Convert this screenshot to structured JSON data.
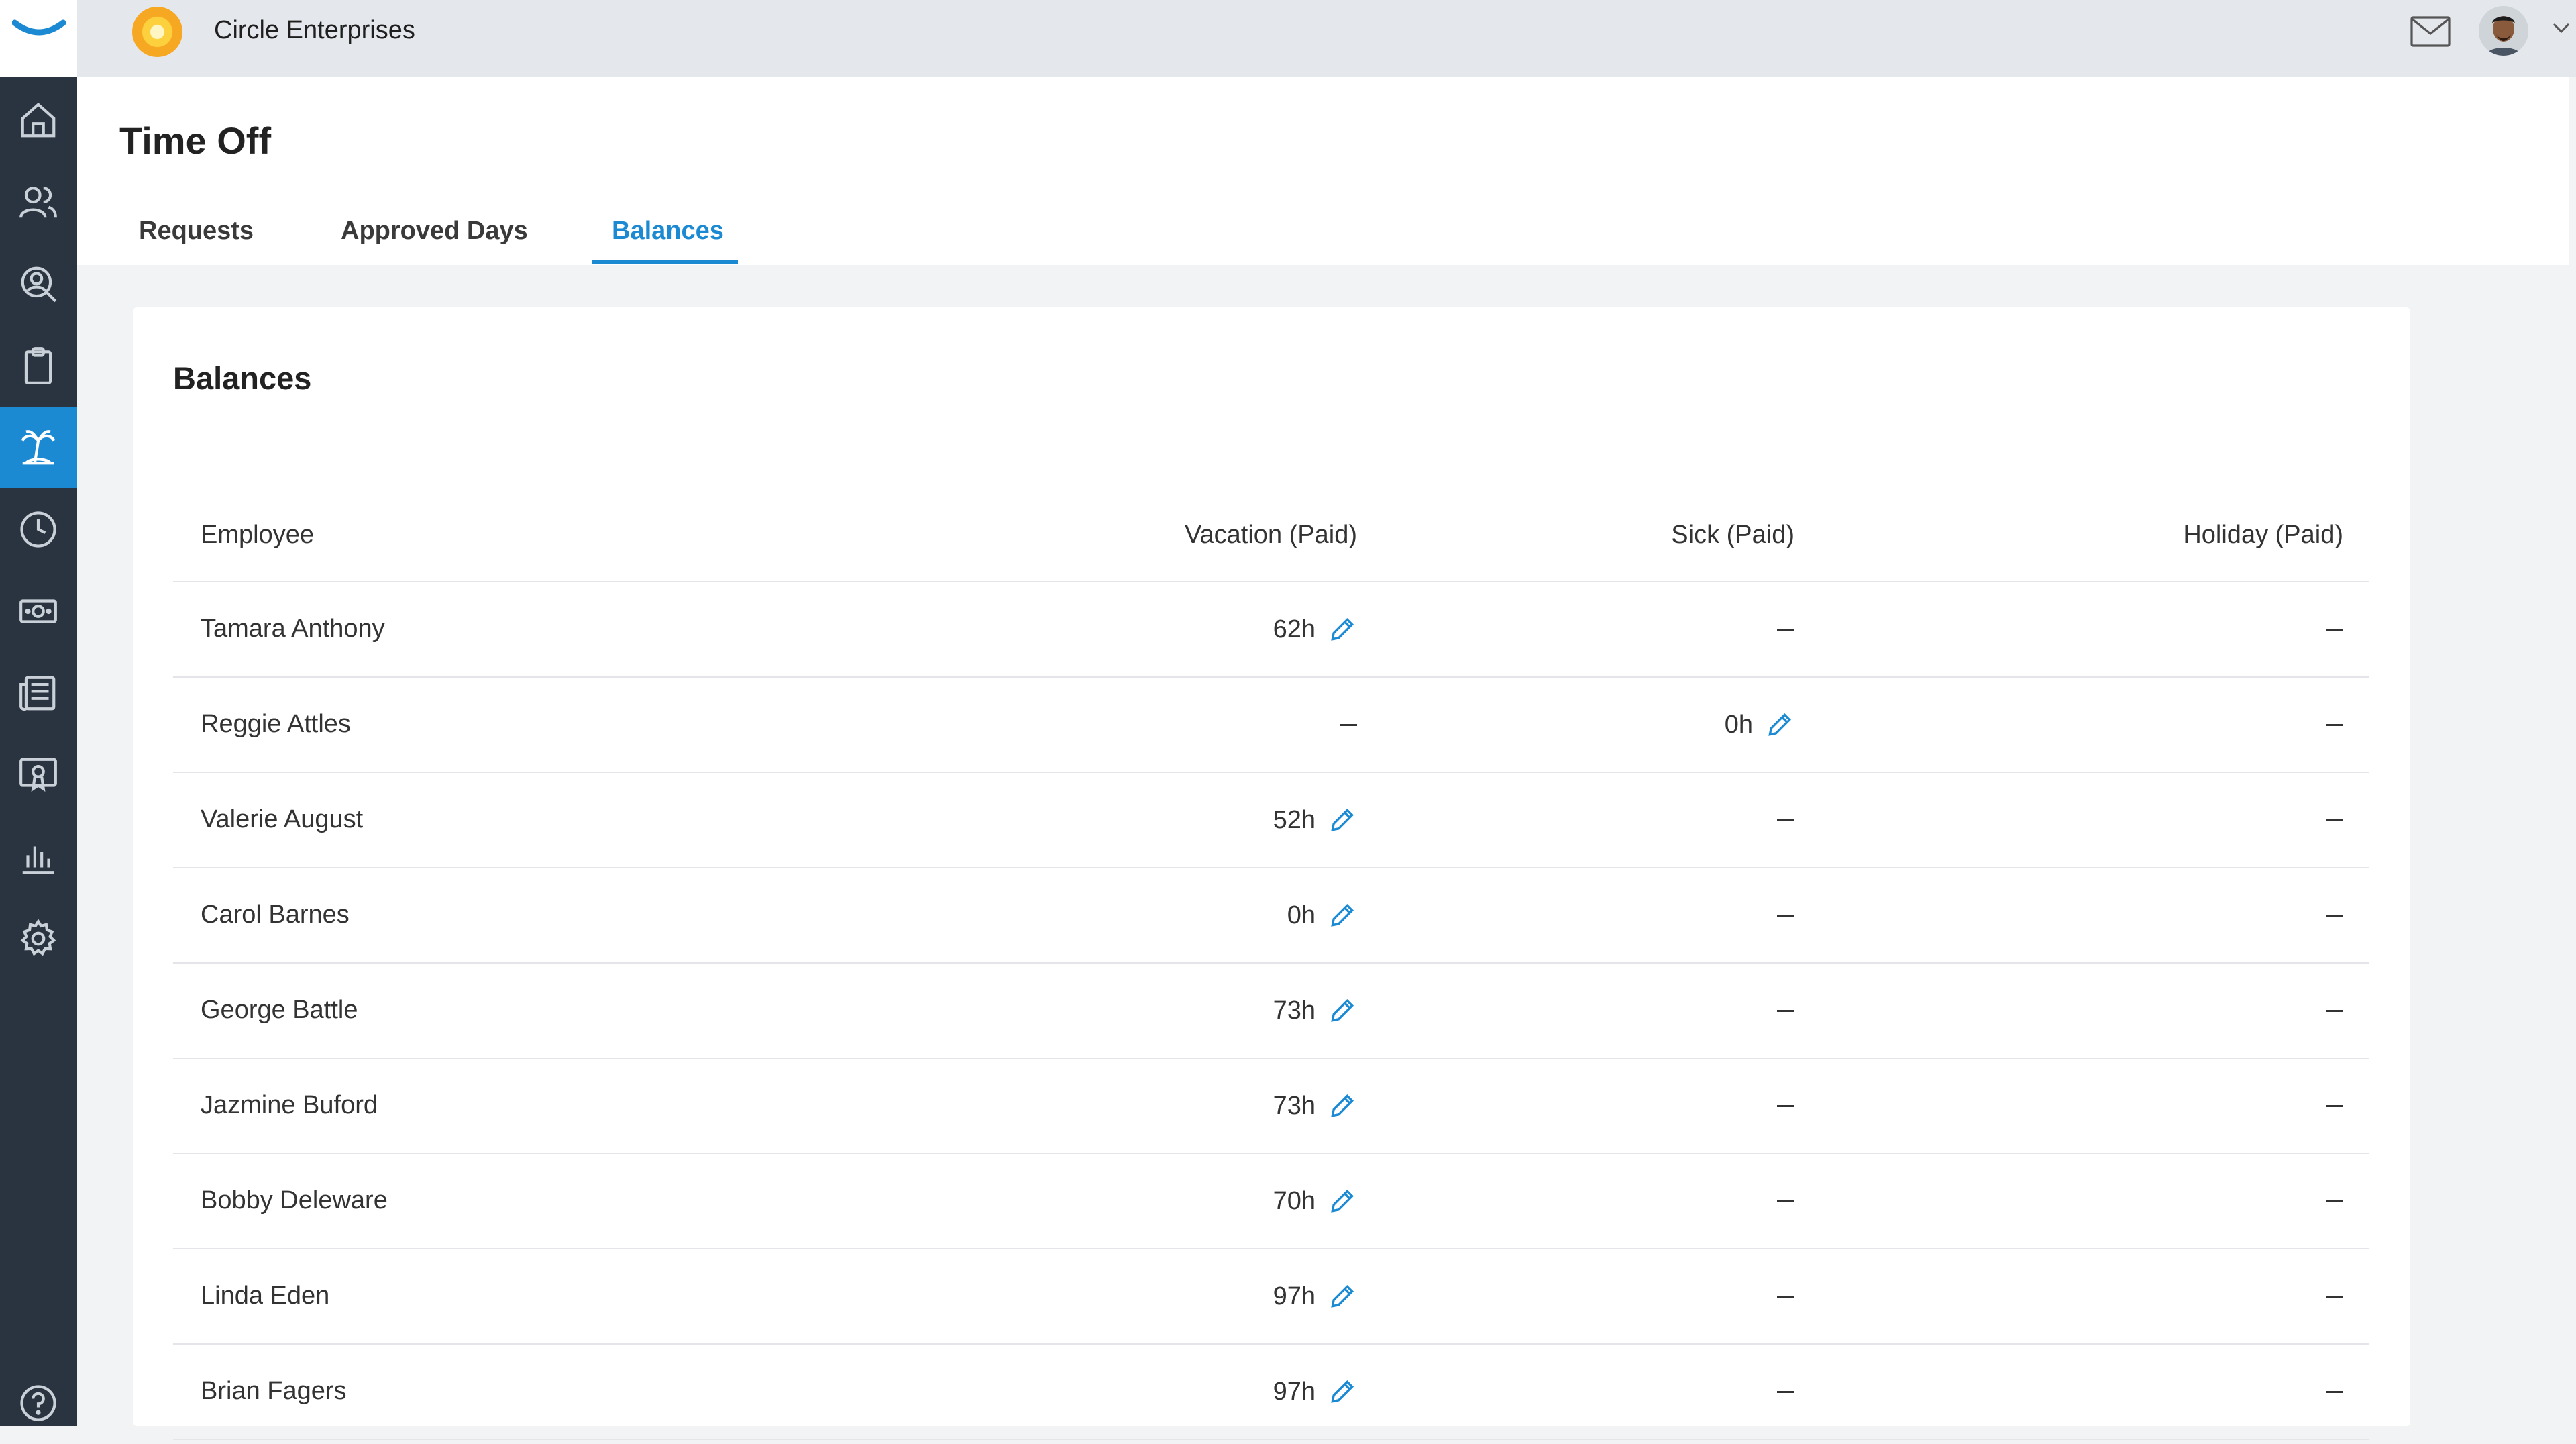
{
  "app": {
    "company_name": "Circle Enterprises",
    "colors": {
      "accent": "#1b8ad3",
      "sidebar": "#2a3440",
      "topbar": "#e4e7eb"
    }
  },
  "sidebar": {
    "items": [
      {
        "icon": "home-icon"
      },
      {
        "icon": "people-icon"
      },
      {
        "icon": "person-search-icon"
      },
      {
        "icon": "clipboard-icon"
      },
      {
        "icon": "palm-tree-icon",
        "active": true
      },
      {
        "icon": "clock-icon"
      },
      {
        "icon": "money-icon"
      },
      {
        "icon": "news-icon"
      },
      {
        "icon": "certificate-icon"
      },
      {
        "icon": "bar-chart-icon"
      },
      {
        "icon": "gear-icon"
      },
      {
        "icon": "help-icon"
      }
    ]
  },
  "header": {
    "title": "Time Off",
    "tabs": [
      {
        "label": "Requests"
      },
      {
        "label": "Approved Days"
      },
      {
        "label": "Balances",
        "active": true
      }
    ]
  },
  "balances": {
    "title": "Balances",
    "columns": {
      "employee": "Employee",
      "vacation": "Vacation (Paid)",
      "sick": "Sick (Paid)",
      "holiday": "Holiday (Paid)"
    },
    "rows": [
      {
        "name": "Tamara Anthony",
        "vacation": "62h",
        "sick": "",
        "holiday": ""
      },
      {
        "name": "Reggie Attles",
        "vacation": "",
        "sick": "0h",
        "holiday": ""
      },
      {
        "name": "Valerie August",
        "vacation": "52h",
        "sick": "",
        "holiday": ""
      },
      {
        "name": "Carol Barnes",
        "vacation": "0h",
        "sick": "",
        "holiday": ""
      },
      {
        "name": "George Battle",
        "vacation": "73h",
        "sick": "",
        "holiday": ""
      },
      {
        "name": "Jazmine Buford",
        "vacation": "73h",
        "sick": "",
        "holiday": ""
      },
      {
        "name": "Bobby Deleware",
        "vacation": "70h",
        "sick": "",
        "holiday": ""
      },
      {
        "name": "Linda Eden",
        "vacation": "97h",
        "sick": "",
        "holiday": ""
      },
      {
        "name": "Brian Fagers",
        "vacation": "97h",
        "sick": "",
        "holiday": ""
      }
    ]
  }
}
